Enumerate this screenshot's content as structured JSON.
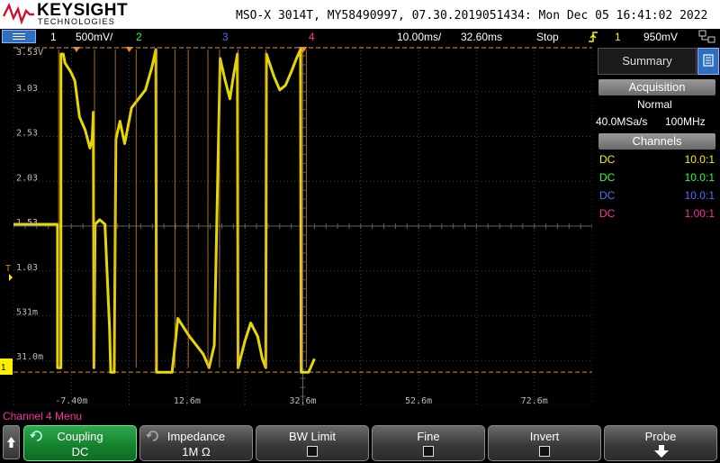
{
  "brand": {
    "name": "KEYSIGHT",
    "sub": "TECHNOLOGIES"
  },
  "instrument_info": "MSO-X 3014T, MY58490997, 07.30.2019051434: Mon Dec 05 16:41:02 2022",
  "status_bar": {
    "ch1_num": "1",
    "ch1_scale": "500mV/",
    "ch2_num": "2",
    "ch3_num": "3",
    "ch4_num": "4",
    "timebase": "10.00ms/",
    "delay": "32.60ms",
    "run_state": "Stop",
    "trigger_source": "1",
    "trigger_level": "950mV"
  },
  "colors": {
    "ch1": "#ffee00",
    "ch2": "#2fff2f",
    "ch3": "#4f6fff",
    "ch4": "#ff2f9f",
    "grid": "#404040",
    "cursor": "#e09030",
    "softkey_active": "#17832f"
  },
  "y_labels": [
    "3.53V",
    "3.03",
    "2.53",
    "2.03",
    "1.53",
    "1.03",
    "531m",
    "31.0m"
  ],
  "x_labels": [
    "-7.40m",
    "12.6m",
    "32.6m",
    "52.6m",
    "72.6m"
  ],
  "waveform": {
    "x_min_ms": -17.4,
    "x_max_ms": 82.6,
    "y_min_v": -0.47,
    "y_max_v": 3.53
  },
  "right_panel": {
    "summary_label": "Summary",
    "acquisition_header": "Acquisition",
    "acq_mode": "Normal",
    "sample_rate": "40.0MSa/s",
    "bandwidth": "100MHz",
    "channels_header": "Channels",
    "channels": [
      {
        "coupling": "DC",
        "probe": "10.0:1"
      },
      {
        "coupling": "DC",
        "probe": "10.0:1"
      },
      {
        "coupling": "DC",
        "probe": "10.0:1"
      },
      {
        "coupling": "DC",
        "probe": "1.00:1"
      }
    ]
  },
  "menu_title": "Channel 4 Menu",
  "softkeys": {
    "coupling": {
      "title": "Coupling",
      "value": "DC"
    },
    "impedance": {
      "title": "Impedance",
      "value": "1M Ω"
    },
    "bw_limit": {
      "title": "BW Limit"
    },
    "fine": {
      "title": "Fine"
    },
    "invert": {
      "title": "Invert"
    },
    "probe": {
      "title": "Probe"
    }
  }
}
